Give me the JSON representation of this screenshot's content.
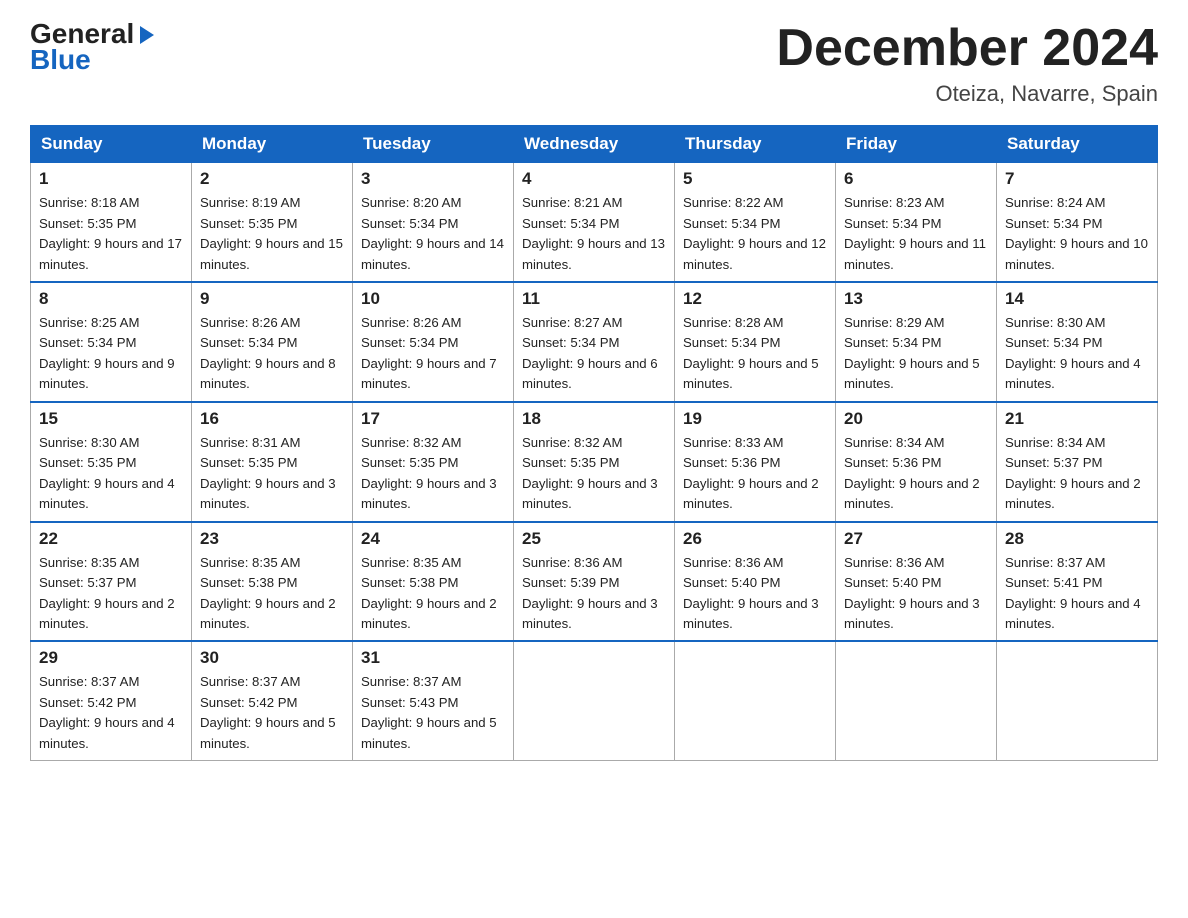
{
  "logo": {
    "general": "General",
    "blue": "Blue"
  },
  "title": "December 2024",
  "location": "Oteiza, Navarre, Spain",
  "days_of_week": [
    "Sunday",
    "Monday",
    "Tuesday",
    "Wednesday",
    "Thursday",
    "Friday",
    "Saturday"
  ],
  "weeks": [
    [
      {
        "day": "1",
        "sunrise": "8:18 AM",
        "sunset": "5:35 PM",
        "daylight": "9 hours and 17 minutes."
      },
      {
        "day": "2",
        "sunrise": "8:19 AM",
        "sunset": "5:35 PM",
        "daylight": "9 hours and 15 minutes."
      },
      {
        "day": "3",
        "sunrise": "8:20 AM",
        "sunset": "5:34 PM",
        "daylight": "9 hours and 14 minutes."
      },
      {
        "day": "4",
        "sunrise": "8:21 AM",
        "sunset": "5:34 PM",
        "daylight": "9 hours and 13 minutes."
      },
      {
        "day": "5",
        "sunrise": "8:22 AM",
        "sunset": "5:34 PM",
        "daylight": "9 hours and 12 minutes."
      },
      {
        "day": "6",
        "sunrise": "8:23 AM",
        "sunset": "5:34 PM",
        "daylight": "9 hours and 11 minutes."
      },
      {
        "day": "7",
        "sunrise": "8:24 AM",
        "sunset": "5:34 PM",
        "daylight": "9 hours and 10 minutes."
      }
    ],
    [
      {
        "day": "8",
        "sunrise": "8:25 AM",
        "sunset": "5:34 PM",
        "daylight": "9 hours and 9 minutes."
      },
      {
        "day": "9",
        "sunrise": "8:26 AM",
        "sunset": "5:34 PM",
        "daylight": "9 hours and 8 minutes."
      },
      {
        "day": "10",
        "sunrise": "8:26 AM",
        "sunset": "5:34 PM",
        "daylight": "9 hours and 7 minutes."
      },
      {
        "day": "11",
        "sunrise": "8:27 AM",
        "sunset": "5:34 PM",
        "daylight": "9 hours and 6 minutes."
      },
      {
        "day": "12",
        "sunrise": "8:28 AM",
        "sunset": "5:34 PM",
        "daylight": "9 hours and 5 minutes."
      },
      {
        "day": "13",
        "sunrise": "8:29 AM",
        "sunset": "5:34 PM",
        "daylight": "9 hours and 5 minutes."
      },
      {
        "day": "14",
        "sunrise": "8:30 AM",
        "sunset": "5:34 PM",
        "daylight": "9 hours and 4 minutes."
      }
    ],
    [
      {
        "day": "15",
        "sunrise": "8:30 AM",
        "sunset": "5:35 PM",
        "daylight": "9 hours and 4 minutes."
      },
      {
        "day": "16",
        "sunrise": "8:31 AM",
        "sunset": "5:35 PM",
        "daylight": "9 hours and 3 minutes."
      },
      {
        "day": "17",
        "sunrise": "8:32 AM",
        "sunset": "5:35 PM",
        "daylight": "9 hours and 3 minutes."
      },
      {
        "day": "18",
        "sunrise": "8:32 AM",
        "sunset": "5:35 PM",
        "daylight": "9 hours and 3 minutes."
      },
      {
        "day": "19",
        "sunrise": "8:33 AM",
        "sunset": "5:36 PM",
        "daylight": "9 hours and 2 minutes."
      },
      {
        "day": "20",
        "sunrise": "8:34 AM",
        "sunset": "5:36 PM",
        "daylight": "9 hours and 2 minutes."
      },
      {
        "day": "21",
        "sunrise": "8:34 AM",
        "sunset": "5:37 PM",
        "daylight": "9 hours and 2 minutes."
      }
    ],
    [
      {
        "day": "22",
        "sunrise": "8:35 AM",
        "sunset": "5:37 PM",
        "daylight": "9 hours and 2 minutes."
      },
      {
        "day": "23",
        "sunrise": "8:35 AM",
        "sunset": "5:38 PM",
        "daylight": "9 hours and 2 minutes."
      },
      {
        "day": "24",
        "sunrise": "8:35 AM",
        "sunset": "5:38 PM",
        "daylight": "9 hours and 2 minutes."
      },
      {
        "day": "25",
        "sunrise": "8:36 AM",
        "sunset": "5:39 PM",
        "daylight": "9 hours and 3 minutes."
      },
      {
        "day": "26",
        "sunrise": "8:36 AM",
        "sunset": "5:40 PM",
        "daylight": "9 hours and 3 minutes."
      },
      {
        "day": "27",
        "sunrise": "8:36 AM",
        "sunset": "5:40 PM",
        "daylight": "9 hours and 3 minutes."
      },
      {
        "day": "28",
        "sunrise": "8:37 AM",
        "sunset": "5:41 PM",
        "daylight": "9 hours and 4 minutes."
      }
    ],
    [
      {
        "day": "29",
        "sunrise": "8:37 AM",
        "sunset": "5:42 PM",
        "daylight": "9 hours and 4 minutes."
      },
      {
        "day": "30",
        "sunrise": "8:37 AM",
        "sunset": "5:42 PM",
        "daylight": "9 hours and 5 minutes."
      },
      {
        "day": "31",
        "sunrise": "8:37 AM",
        "sunset": "5:43 PM",
        "daylight": "9 hours and 5 minutes."
      },
      null,
      null,
      null,
      null
    ]
  ]
}
